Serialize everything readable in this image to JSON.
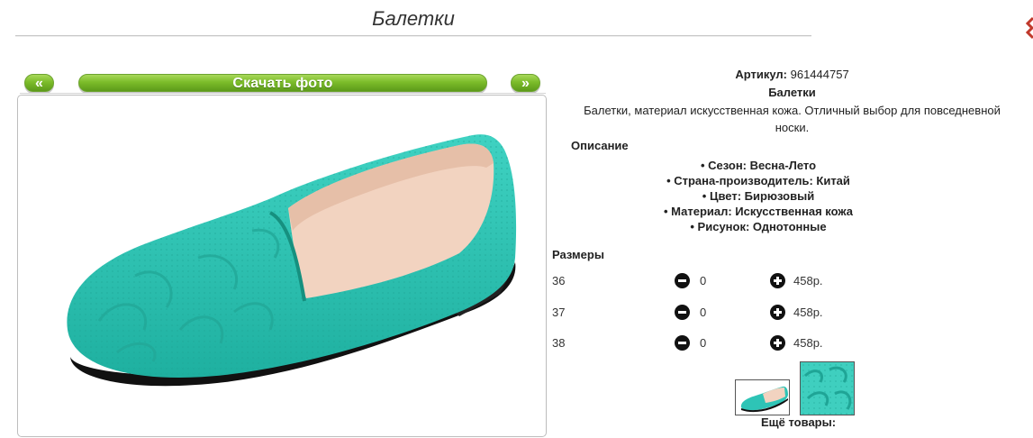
{
  "page": {
    "title": "Балетки"
  },
  "gallery": {
    "prev_label": "«",
    "download_label": "Скачать фото",
    "next_label": "»"
  },
  "product": {
    "sku_label": "Артикул:",
    "sku_value": "961444757",
    "name": "Балетки",
    "summary_line1": "Балетки, материал искусственная кожа. Отличный выбор для повседневной",
    "summary_line2": "носки.",
    "description_heading": "Описание",
    "attributes": [
      "• Сезон: Весна-Лето",
      "• Страна-производитель: Китай",
      "• Цвет: Бирюзовый",
      "• Материал: Искусственная кожа",
      "• Рисунок: Однотонные"
    ]
  },
  "sizes": {
    "heading": "Размеры",
    "rows": [
      {
        "size": "36",
        "qty": "0",
        "price": "458р."
      },
      {
        "size": "37",
        "qty": "0",
        "price": "458р."
      },
      {
        "size": "38",
        "qty": "0",
        "price": "458р."
      }
    ]
  },
  "more_products_label": "Ещё товары:",
  "colors": {
    "accent_green": "#7cbc2a",
    "shoe_turquoise": "#2ec4b6",
    "lining": "#f2d3c0"
  }
}
